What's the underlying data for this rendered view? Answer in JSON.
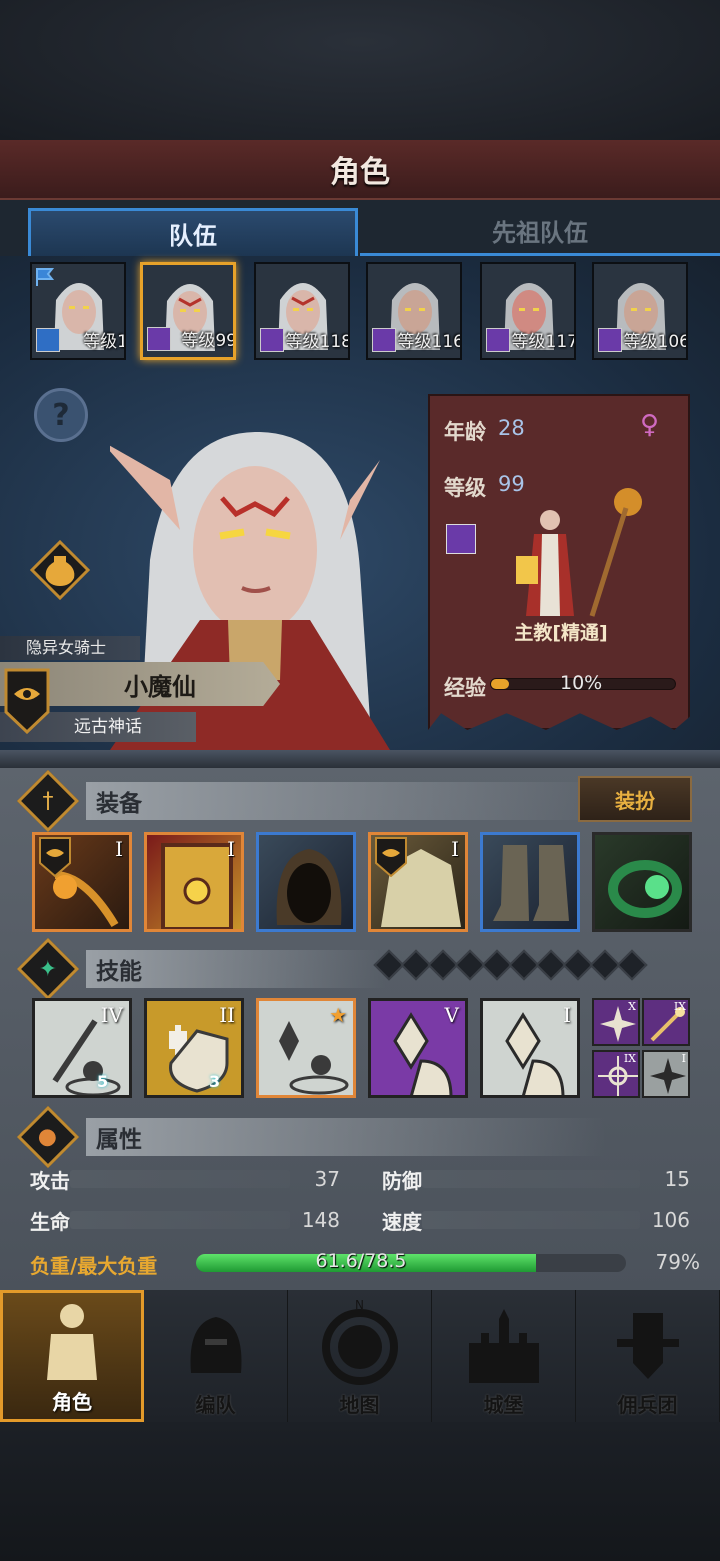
{
  "header": {
    "title": "角色"
  },
  "tabs": [
    {
      "label": "队伍",
      "active": true
    },
    {
      "label": "先祖队伍",
      "active": false
    }
  ],
  "party": [
    {
      "level": "等级1",
      "selected": false,
      "flag": true
    },
    {
      "level": "等级99",
      "selected": true
    },
    {
      "level": "等级118",
      "selected": false
    },
    {
      "level": "等级116",
      "selected": false
    },
    {
      "level": "等级117",
      "selected": false
    },
    {
      "level": "等级106",
      "selected": false
    }
  ],
  "help": {
    "symbol": "?"
  },
  "character": {
    "title": "隐异女骑士",
    "name": "小魔仙",
    "subtitle": "远古神话",
    "age_label": "年龄",
    "age": "28",
    "level_label": "等级",
    "level": "99",
    "gender_symbol": "♀",
    "job": "主教[精通]",
    "exp_label": "经验",
    "exp_pct": "10%",
    "exp_fraction": 0.1
  },
  "equipment": {
    "label": "装备",
    "dress_button": "装扮",
    "items": [
      {
        "name": "staff",
        "rank": "I",
        "rarity": "orange"
      },
      {
        "name": "tome",
        "rank": "I",
        "rarity": "orange"
      },
      {
        "name": "hood",
        "rank": "",
        "rarity": "blue"
      },
      {
        "name": "robe",
        "rank": "I",
        "rarity": "orange"
      },
      {
        "name": "boots",
        "rank": "",
        "rarity": "blue"
      },
      {
        "name": "ring",
        "rank": "",
        "rarity": "green"
      }
    ]
  },
  "skills": {
    "label": "技能",
    "slot_count": 10,
    "items": [
      {
        "name": "staff-heal",
        "rank": "IV",
        "count": "5",
        "style": "light"
      },
      {
        "name": "shield-bless",
        "rank": "II",
        "count": "3",
        "style": "gold"
      },
      {
        "name": "crystal-aura",
        "rank": "★",
        "count": "",
        "style": "light-orange"
      },
      {
        "name": "crystal-strike",
        "rank": "V",
        "count": "",
        "style": "purple"
      },
      {
        "name": "crystal-hand",
        "rank": "I",
        "count": "",
        "style": "light"
      }
    ],
    "passives": [
      {
        "name": "burst",
        "rank": "X"
      },
      {
        "name": "wand",
        "rank": "IX"
      },
      {
        "name": "holy-star",
        "rank": "IX"
      },
      {
        "name": "blast",
        "rank": "I"
      }
    ]
  },
  "attributes": {
    "label": "属性",
    "stats": [
      {
        "key": "攻击",
        "value": "37"
      },
      {
        "key": "防御",
        "value": "15"
      },
      {
        "key": "生命",
        "value": "148"
      },
      {
        "key": "速度",
        "value": "106"
      }
    ],
    "weight_label": "负重/最大负重",
    "weight_value": "61.6/78.5",
    "weight_pct": "79%",
    "weight_fraction": 0.79
  },
  "nav": [
    {
      "label": "角色",
      "active": true
    },
    {
      "label": "编队",
      "active": false
    },
    {
      "label": "地图",
      "active": false
    },
    {
      "label": "城堡",
      "active": false
    },
    {
      "label": "佣兵团",
      "active": false
    }
  ],
  "colors": {
    "accent": "#e39a2a",
    "tab_blue": "#3a8ad6",
    "banner": "#5a2a2a",
    "weight_green": "#2fbf4a"
  }
}
